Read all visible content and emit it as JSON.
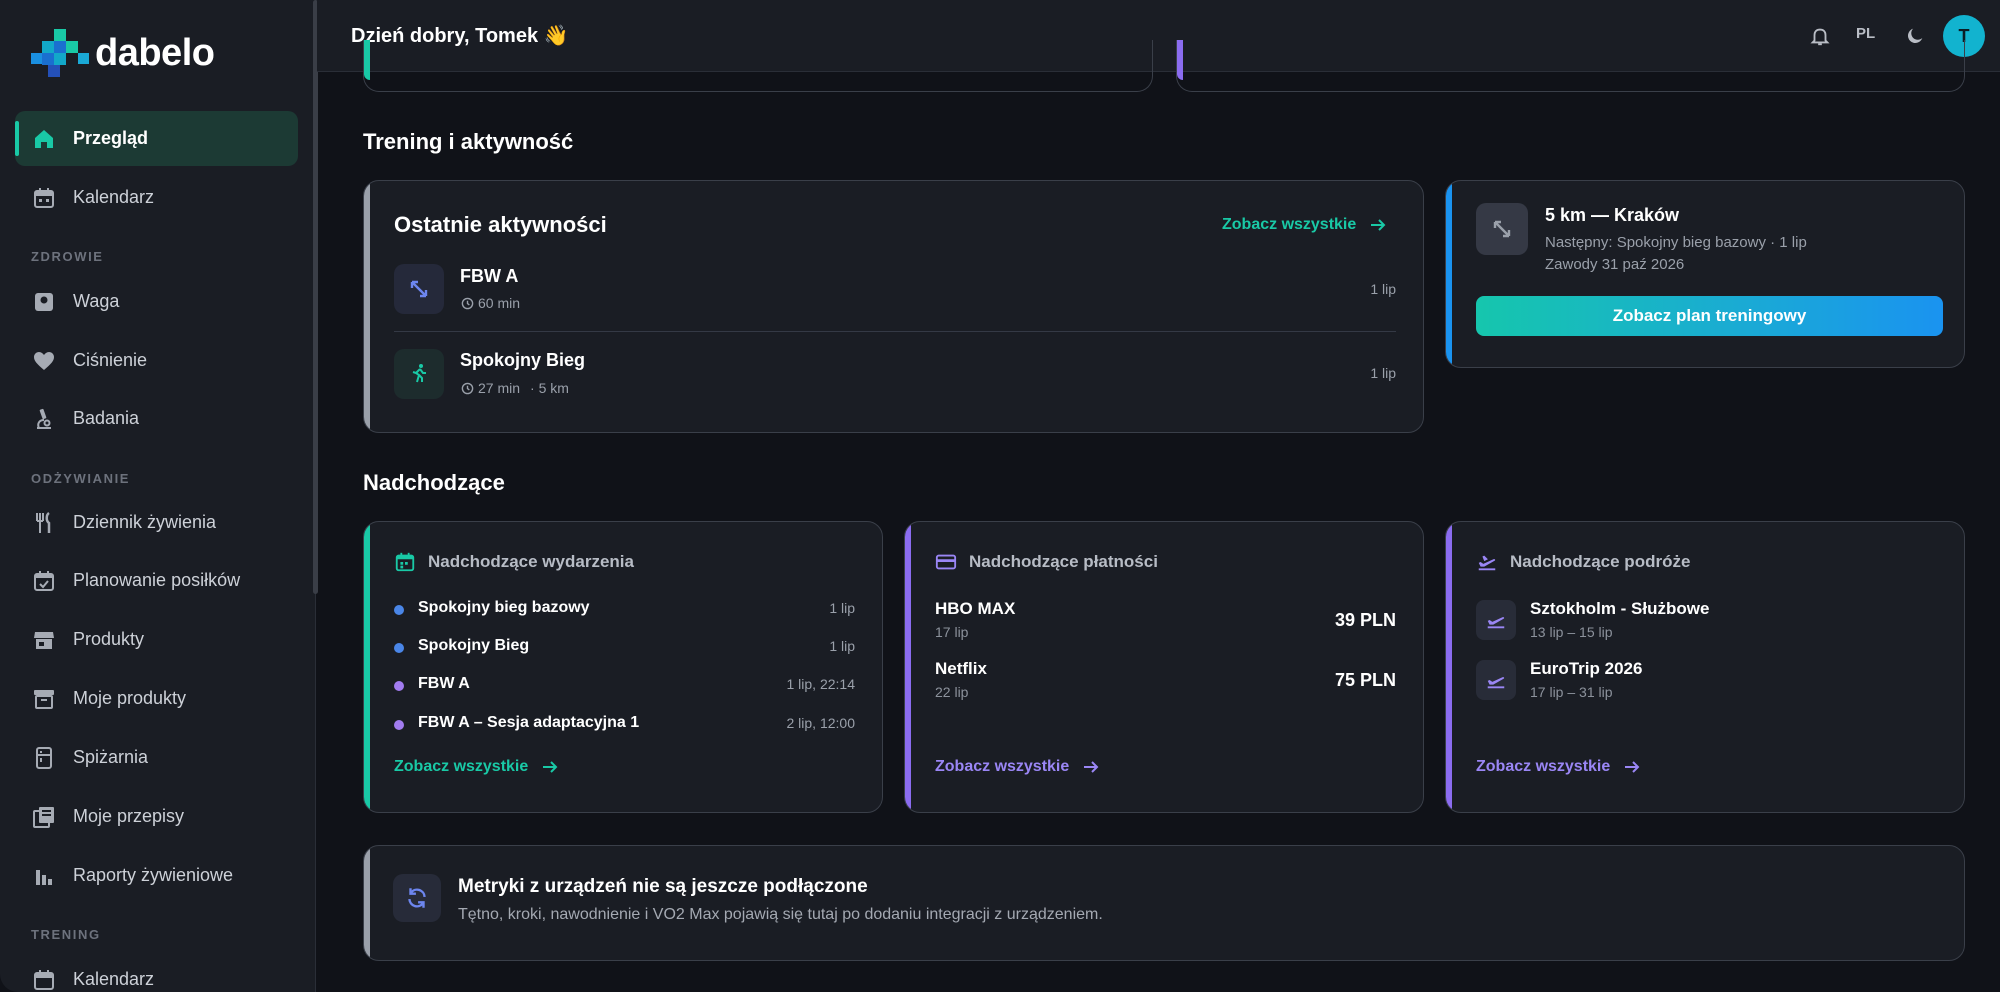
{
  "app": {
    "brand": "dabelo",
    "greeting": "Dzień dobry, Tomek 👋",
    "language": "PL",
    "avatar_initial": "T",
    "accent": "#19c9a6"
  },
  "sidebar": {
    "items": [
      {
        "label": "Przegląd",
        "icon": "home-icon",
        "active": true
      },
      {
        "label": "Kalendarz",
        "icon": "calendar-icon"
      },
      {
        "label": "Waga",
        "icon": "scale-icon"
      },
      {
        "label": "Ciśnienie",
        "icon": "heart-icon"
      },
      {
        "label": "Badania",
        "icon": "microscope-icon"
      },
      {
        "label": "Dziennik żywienia",
        "icon": "cutlery-icon"
      },
      {
        "label": "Planowanie posiłków",
        "icon": "calendar-check-icon"
      },
      {
        "label": "Produkty",
        "icon": "store-icon"
      },
      {
        "label": "Moje produkty",
        "icon": "archive-icon"
      },
      {
        "label": "Spiżarnia",
        "icon": "pantry-icon"
      },
      {
        "label": "Moje przepisy",
        "icon": "recipes-icon"
      },
      {
        "label": "Raporty żywieniowe",
        "icon": "bar-chart-icon"
      },
      {
        "label": "Kalendarz",
        "icon": "calendar-icon"
      }
    ],
    "sections": {
      "health": "ZDROWIE",
      "nutrition": "ODŻYWIANIE",
      "training": "TRENING"
    }
  },
  "training": {
    "section_title": "Trening i aktywność",
    "recent": {
      "title": "Ostatnie aktywności",
      "see_all": "Zobacz wszystkie",
      "items": [
        {
          "name": "FBW A",
          "duration": "60 min",
          "distance": "",
          "date": "1 lip",
          "icon": "expand-arrows-icon"
        },
        {
          "name": "Spokojny Bieg",
          "duration": "27 min",
          "distance": "· 5 km",
          "date": "1 lip",
          "icon": "runner-icon"
        }
      ]
    },
    "plan": {
      "title": "5 km — Kraków",
      "next": "Następny: Spokojny bieg bazowy · 1 lip",
      "race": "Zawody 31 paź 2026",
      "button": "Zobacz plan treningowy"
    }
  },
  "upcoming": {
    "section_title": "Nadchodzące",
    "events": {
      "title": "Nadchodzące wydarzenia",
      "see_all": "Zobacz wszystkie",
      "items": [
        {
          "name": "Spokojny bieg bazowy",
          "date": "1 lip",
          "color": "#4a86e8"
        },
        {
          "name": "Spokojny Bieg",
          "date": "1 lip",
          "color": "#4a86e8"
        },
        {
          "name": "FBW A",
          "date": "1 lip, 22:14",
          "color": "#a27cf0"
        },
        {
          "name": "FBW A – Sesja adaptacyjna 1",
          "date": "2 lip, 12:00",
          "color": "#a27cf0"
        }
      ]
    },
    "payments": {
      "title": "Nadchodzące płatności",
      "see_all": "Zobacz wszystkie",
      "items": [
        {
          "name": "HBO MAX",
          "date": "17 lip",
          "amount": "39 PLN"
        },
        {
          "name": "Netflix",
          "date": "22 lip",
          "amount": "75 PLN"
        }
      ]
    },
    "trips": {
      "title": "Nadchodzące podróże",
      "see_all": "Zobacz wszystkie",
      "items": [
        {
          "name": "Sztokholm - Służbowe",
          "dates": "13 lip – 15 lip"
        },
        {
          "name": "EuroTrip 2026",
          "dates": "17 lip – 31 lip"
        }
      ]
    }
  },
  "metrics": {
    "title": "Metryki z urządzeń nie są jeszcze podłączone",
    "description": "Tętno, kroki, nawodnienie i VO2 Max pojawią się tutaj po dodaniu integracji z urządzeniem."
  }
}
